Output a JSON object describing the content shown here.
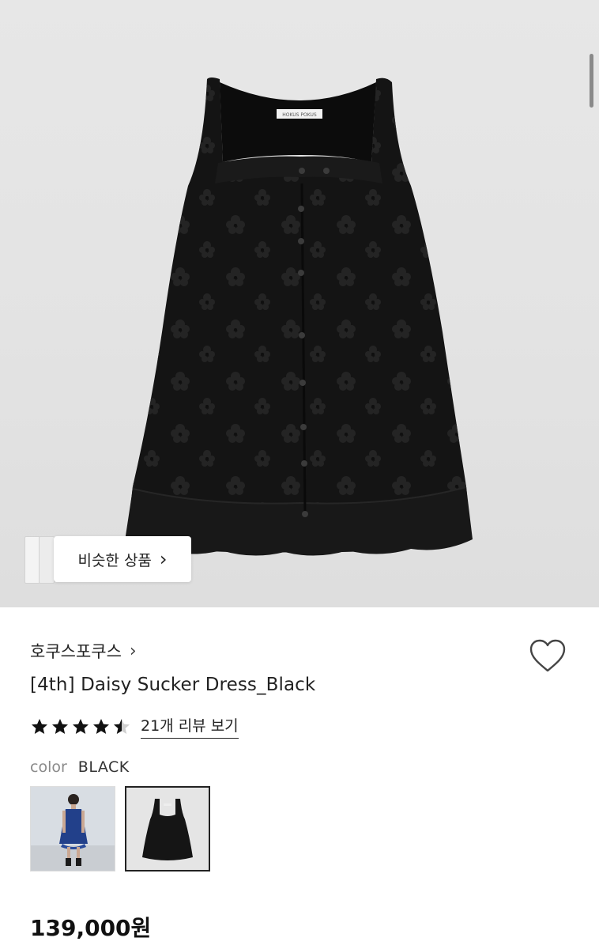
{
  "product_image": {
    "alt": "product-image",
    "garment_label": "HOKUS POKUS"
  },
  "similar": {
    "label": "비슷한 상품",
    "chevron": "›"
  },
  "brand": {
    "name": "호쿠스포쿠스",
    "chevron": "›"
  },
  "product": {
    "title": "[4th] Daisy Sucker Dress_Black"
  },
  "rating": {
    "value": 4.5,
    "max": 5,
    "review_link": "21개 리뷰 보기"
  },
  "color": {
    "label": "color",
    "value": "BLACK",
    "options": [
      "blue-model-photo",
      "black-dress-photo"
    ],
    "selected": 1
  },
  "price": {
    "text": "139,000원"
  },
  "icons": {
    "heart": "heart-outline-icon",
    "star": "star-icon"
  },
  "colors": {
    "star_fill": "#111111",
    "dress": "#141414"
  }
}
